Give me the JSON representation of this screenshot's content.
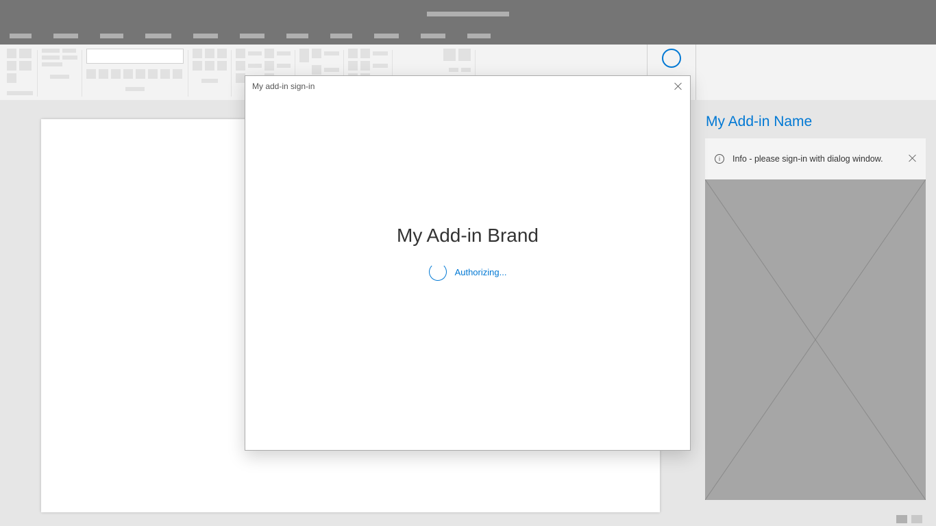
{
  "dialog": {
    "title": "My add-in sign-in",
    "brand": "My Add-in Brand",
    "status": "Authorizing..."
  },
  "taskpane": {
    "title": "My Add-in Name",
    "info_message": "Info - please sign-in with dialog window."
  }
}
